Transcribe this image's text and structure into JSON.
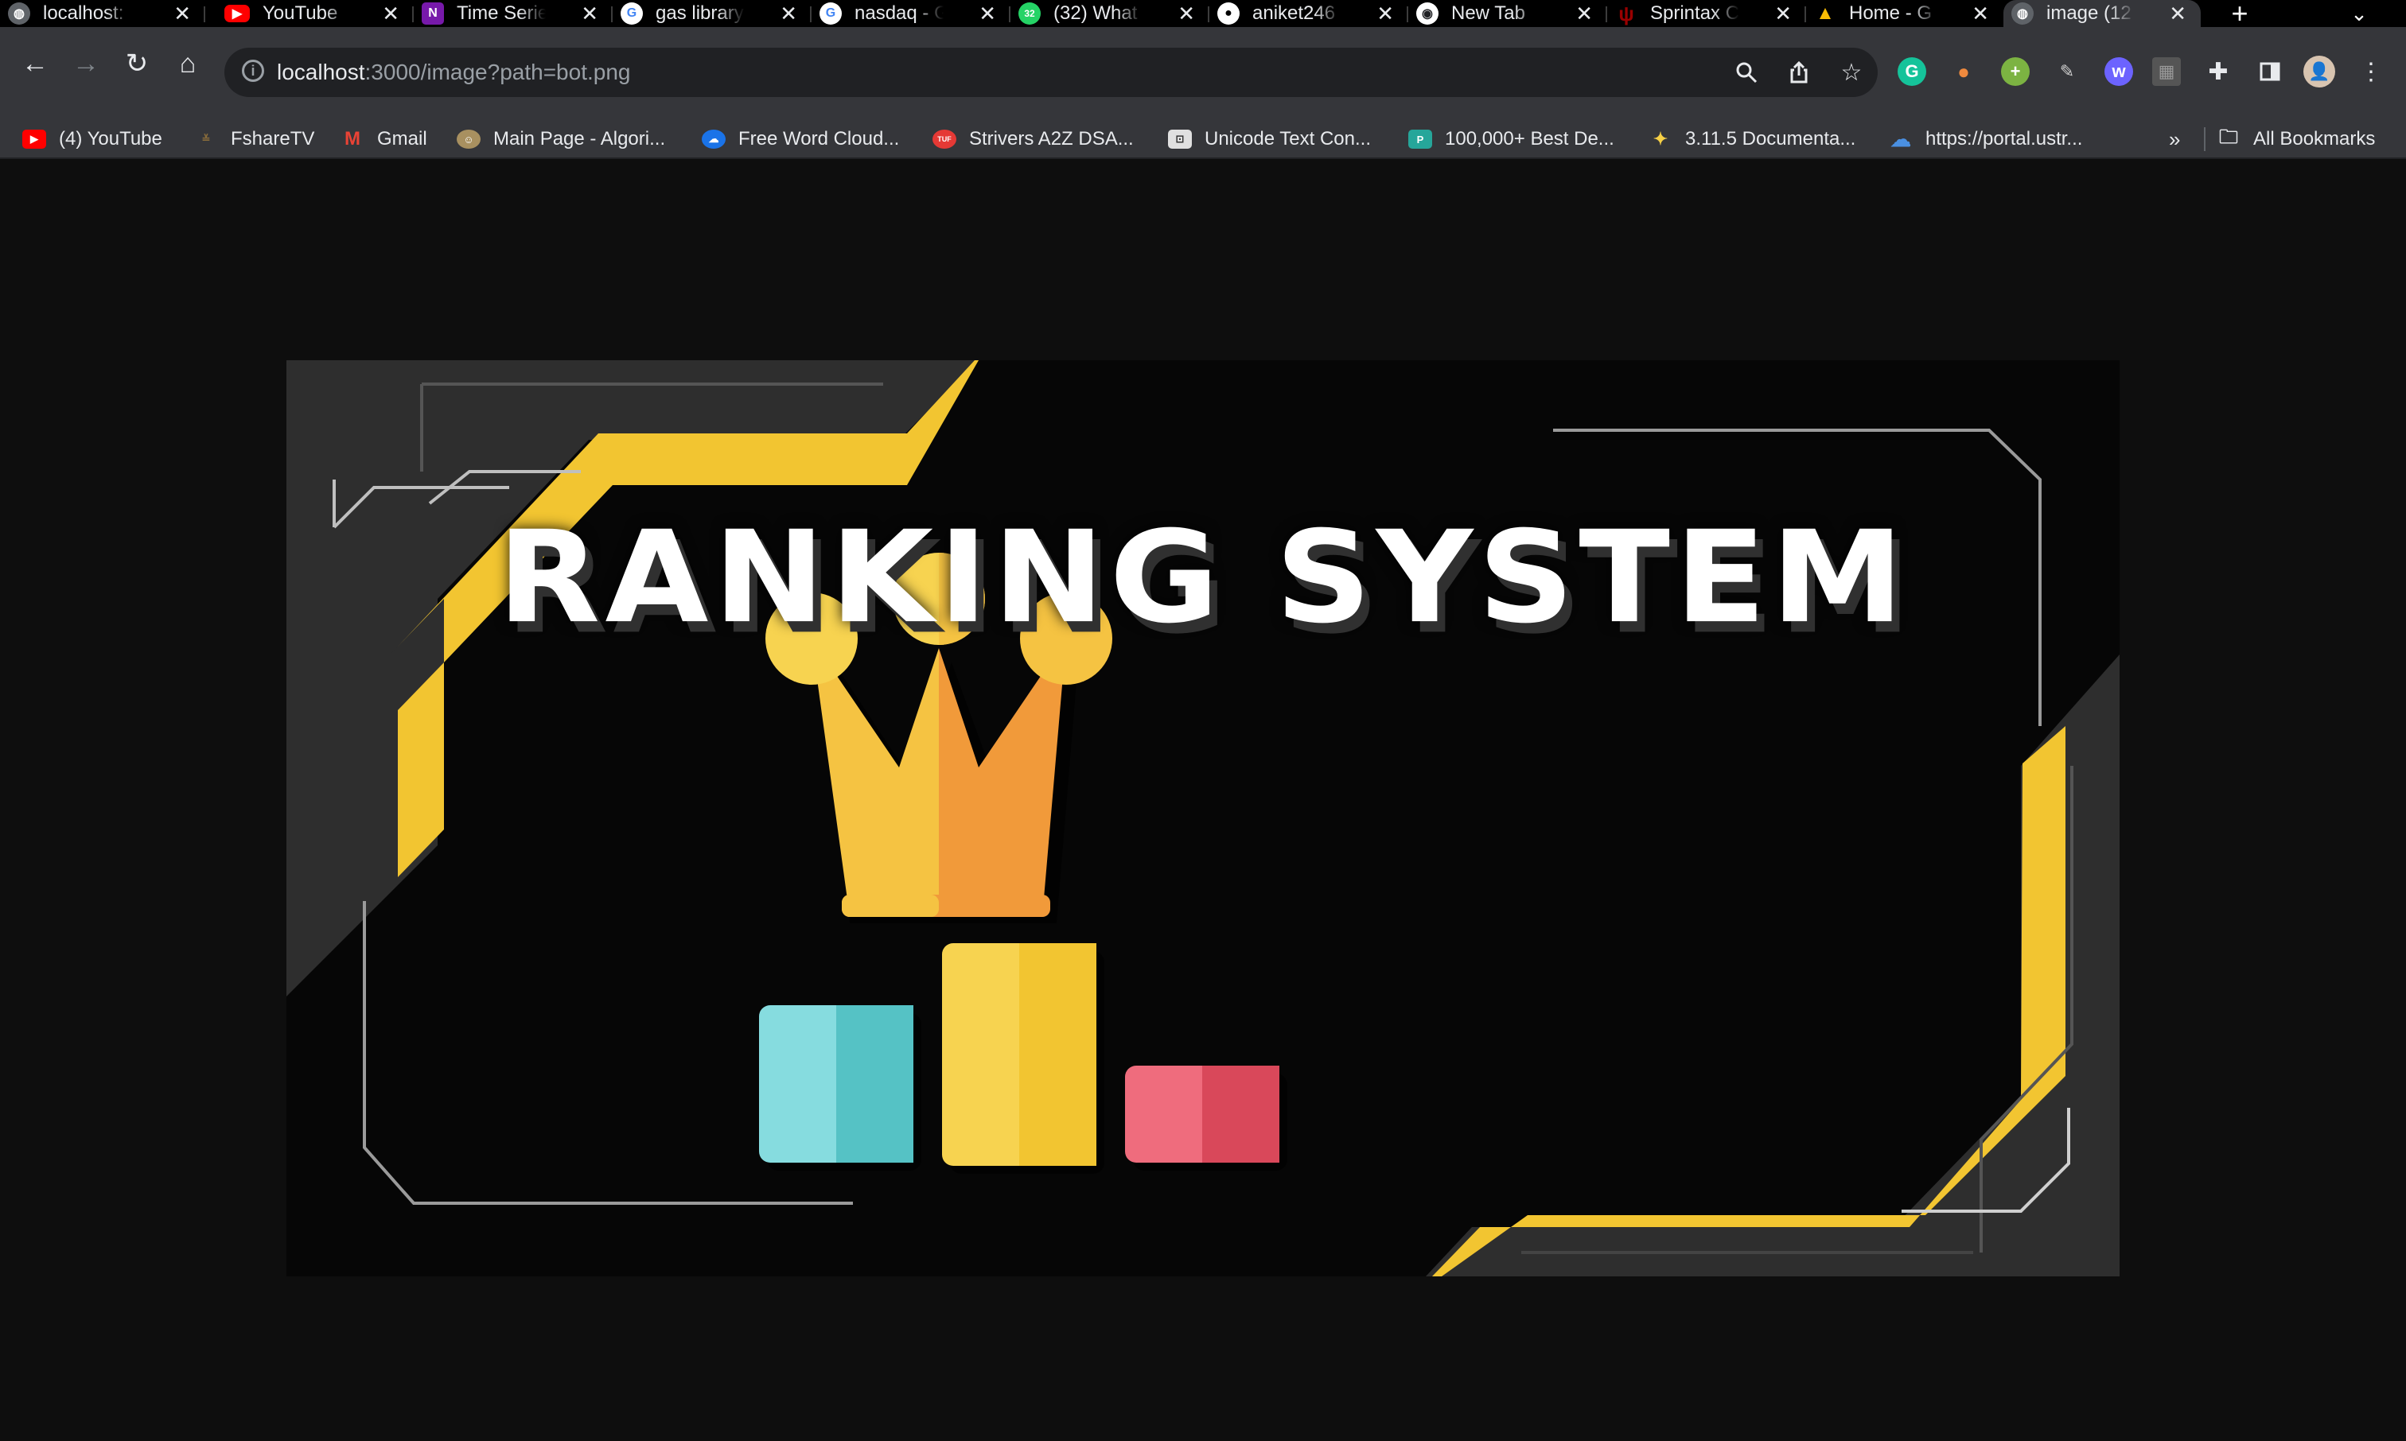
{
  "tabs": [
    {
      "title": "localhost:",
      "icon": "globe-icon",
      "color": "#5f6368"
    },
    {
      "title": "YouTube",
      "icon": "youtube-icon",
      "color": "#ff0000"
    },
    {
      "title": "Time Serie",
      "icon": "onenote-icon",
      "color": "#7719aa"
    },
    {
      "title": "gas library",
      "icon": "google-icon",
      "color": "#ffffff"
    },
    {
      "title": "nasdaq - G",
      "icon": "google-icon",
      "color": "#ffffff"
    },
    {
      "title": "(32) What",
      "icon": "whatsapp-icon",
      "color": "#25d366",
      "badge": "32"
    },
    {
      "title": "aniket246",
      "icon": "github-icon",
      "color": "#ffffff"
    },
    {
      "title": "New Tab",
      "icon": "chrome-icon",
      "color": "#ffffff"
    },
    {
      "title": "Sprintax C",
      "icon": "iu-icon",
      "color": "#990000"
    },
    {
      "title": "Home - G",
      "icon": "drive-icon",
      "color": "#fbbc04"
    },
    {
      "title": "image (12",
      "icon": "globe-icon",
      "color": "#5f6368",
      "active": true
    }
  ],
  "address_bar": {
    "host": "localhost",
    "path": ":3000/image?path=bot.png"
  },
  "bookmarks": [
    {
      "label": "(4) YouTube",
      "icon": "youtube-icon",
      "color": "#ff0000"
    },
    {
      "label": "FshareTV",
      "icon": "fsharetv-icon",
      "color": "#8a6d3b"
    },
    {
      "label": "Gmail",
      "icon": "gmail-icon",
      "color": "#ea4335"
    },
    {
      "label": "Main Page - Algori...",
      "icon": "algorithmica-icon",
      "color": "#a89060"
    },
    {
      "label": "Free Word Cloud...",
      "icon": "wordcloud-icon",
      "color": "#1a73e8"
    },
    {
      "label": "Strivers A2Z DSA...",
      "icon": "tuf-icon",
      "color": "#e53935"
    },
    {
      "label": "Unicode Text Con...",
      "icon": "unicode-icon",
      "color": "#bdbdbd"
    },
    {
      "label": "100,000+ Best De...",
      "icon": "design-icon",
      "color": "#26a69a"
    },
    {
      "label": "3.11.5 Documenta...",
      "icon": "python-icon",
      "color": "#3776ab"
    },
    {
      "label": "https://portal.ustr...",
      "icon": "cloud-icon",
      "color": "#4a90e2"
    }
  ],
  "bookmarks_overflow": "»",
  "all_bookmarks": "All Bookmarks",
  "hero": {
    "title": "RANKING SYSTEM"
  },
  "colors": {
    "gold": "#f2c531",
    "crown_light": "#f5c342",
    "crown_dark": "#f19a3a",
    "teal": "#5bc8cb",
    "yellow": "#f7d350",
    "red": "#e04c5a",
    "panel": "#2e2e2e"
  }
}
